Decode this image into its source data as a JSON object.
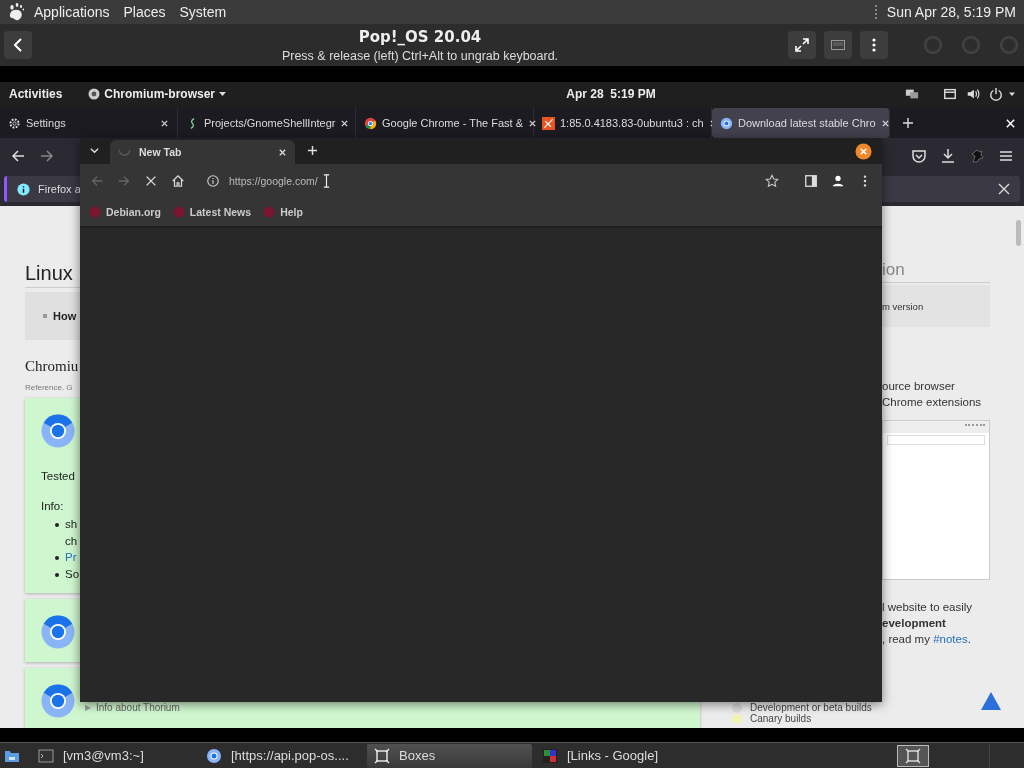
{
  "top_panel": {
    "menus": [
      "Applications",
      "Places",
      "System"
    ],
    "clock": "Sun Apr 28, 5:19 PM"
  },
  "boxes_header": {
    "title": "Pop!_OS 20.04",
    "subtitle": "Press & release (left) Ctrl+Alt to ungrab keyboard."
  },
  "gnome_bar": {
    "activities": "Activities",
    "app_menu": "Chromium-browser",
    "clock": "Apr 28  5:19 PM"
  },
  "firefox": {
    "tabs": [
      {
        "label": "Settings",
        "kind": "settings",
        "selected": false
      },
      {
        "label": "Projects/GnomeShellIntegr",
        "kind": "gitlab",
        "selected": false
      },
      {
        "label": "Google Chrome - The Fast &",
        "kind": "chrome",
        "selected": false
      },
      {
        "label": "1:85.0.4183.83-0ubuntu3 : ch",
        "kind": "launchpad",
        "selected": false
      },
      {
        "label": "Download latest stable Chro",
        "kind": "chromium",
        "selected": true
      }
    ],
    "notification": "Firefox a",
    "page": {
      "left": {
        "heading": "Linux",
        "toc_item": "How",
        "section_title": "Chromiu",
        "reference": "Reference. G",
        "cards": [
          {
            "kind": "full",
            "text": "Tested",
            "info_label": "Info:",
            "bullets": [
              {
                "lines": [
                  "sh",
                  "ch"
                ],
                "kind": "text"
              },
              {
                "lines": [
                  "Pr"
                ],
                "kind": "link"
              },
              {
                "lines": [
                  "So"
                ],
                "kind": "text"
              }
            ]
          },
          {
            "kind": "compact"
          },
          {
            "kind": "footer",
            "footer": "Info about Thorium"
          }
        ]
      },
      "right": {
        "heading": "ion",
        "toc_item": "m version",
        "lines": [
          "ource browser",
          "Chrome extensions"
        ],
        "lines_after": [
          "l website to easily"
        ],
        "bold_line": "evelopment",
        "notes_text": ", read my ",
        "notes_link": "#notes",
        "notes_end": "."
      },
      "options": [
        {
          "label": "Development or beta builds",
          "color": "#d9d9d9"
        },
        {
          "label": "Canary builds",
          "color": "#f3f3b4"
        }
      ]
    }
  },
  "chromium": {
    "tabs": [
      {
        "label": "New Tab",
        "selected": true,
        "loading": true
      }
    ],
    "url": "https://google.com/",
    "bookmarks": [
      "Debian.org",
      "Latest News",
      "Help"
    ]
  },
  "taskbar": {
    "items": [
      {
        "kind": "files",
        "selected": false
      },
      {
        "kind": "terminal",
        "label": "[vm3@vm3:~]",
        "selected": false
      },
      {
        "kind": "chromium",
        "label": "[https://api.pop-os....",
        "selected": false
      },
      {
        "kind": "boxes",
        "label": "Boxes",
        "selected": true
      },
      {
        "kind": "links",
        "label": "[Links - Google]",
        "selected": false
      }
    ]
  }
}
